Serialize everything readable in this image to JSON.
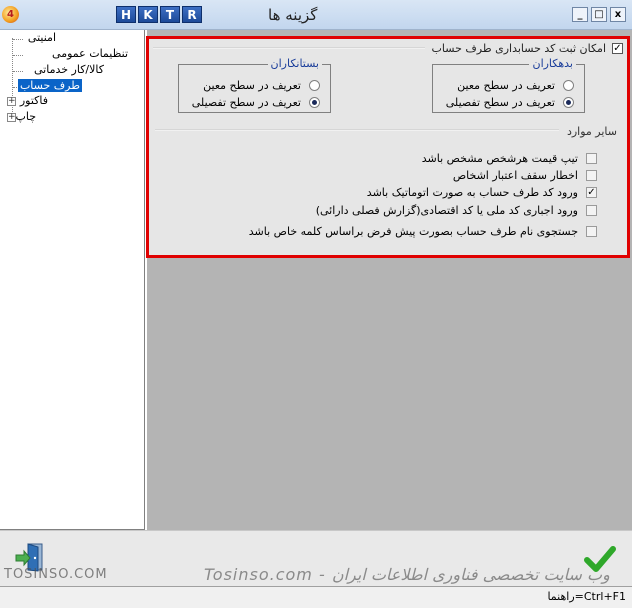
{
  "window": {
    "title": "گزینه ها",
    "hktr": [
      "H",
      "K",
      "T",
      "R"
    ],
    "app_icon_glyph": "4",
    "controls": [
      "_",
      "□",
      "x"
    ]
  },
  "tree": {
    "items": [
      {
        "label": "امنیتی",
        "expandable": false,
        "selected": false
      },
      {
        "label": "تنظیمات عمومی",
        "expandable": false,
        "selected": false
      },
      {
        "label": "کالا/کار خدماتی",
        "expandable": false,
        "selected": false
      },
      {
        "label": "طرف حساب",
        "expandable": false,
        "selected": true
      },
      {
        "label": "فاکتور",
        "expandable": true,
        "selected": false
      },
      {
        "label": "چاپ",
        "expandable": true,
        "selected": false
      }
    ]
  },
  "settings": {
    "enable_accounting": {
      "label": "امکان ثبت کد حسابداری طرف حساب",
      "checked": true
    },
    "debtors": {
      "legend": "بدهکاران",
      "options": [
        {
          "label": "تعریف در سطح معین",
          "selected": false
        },
        {
          "label": "تعریف در سطح تفصیلی",
          "selected": true
        }
      ]
    },
    "creditors": {
      "legend": "بستانکاران",
      "options": [
        {
          "label": "تعریف در سطح معین",
          "selected": false
        },
        {
          "label": "تعریف در سطح تفصیلی",
          "selected": true
        }
      ]
    },
    "other_title": "سایر موارد",
    "other_options": [
      {
        "label": "تیپ قیمت هرشخص مشخص باشد",
        "checked": false
      },
      {
        "label": "اخطار سقف اعتبار اشخاص",
        "checked": false
      },
      {
        "label": "ورود کد طرف حساب  به صورت اتوماتیک باشد",
        "checked": true
      },
      {
        "label": "ورود اجباری کد ملی یا کد اقتصادی(گزارش فصلی دارائی)",
        "checked": false
      },
      {
        "label": "جستجوی نام  طرف حساب  بصورت پیش فرض براساس کلمه خاص باشد",
        "checked": false
      }
    ]
  },
  "watermark": {
    "left": "TOSINSO.COM",
    "center": "Tosinso.com - وب سایت تخصصی فناوری اطلاعات ایران"
  },
  "status": {
    "hint": "راهنما=Ctrl+F1"
  },
  "colors": {
    "highlight_frame": "#e00000",
    "selection": "#0a64c8",
    "ok_green": "#2fa82a"
  },
  "icons": {
    "exit": "exit-door-icon",
    "ok": "checkmark-icon"
  }
}
